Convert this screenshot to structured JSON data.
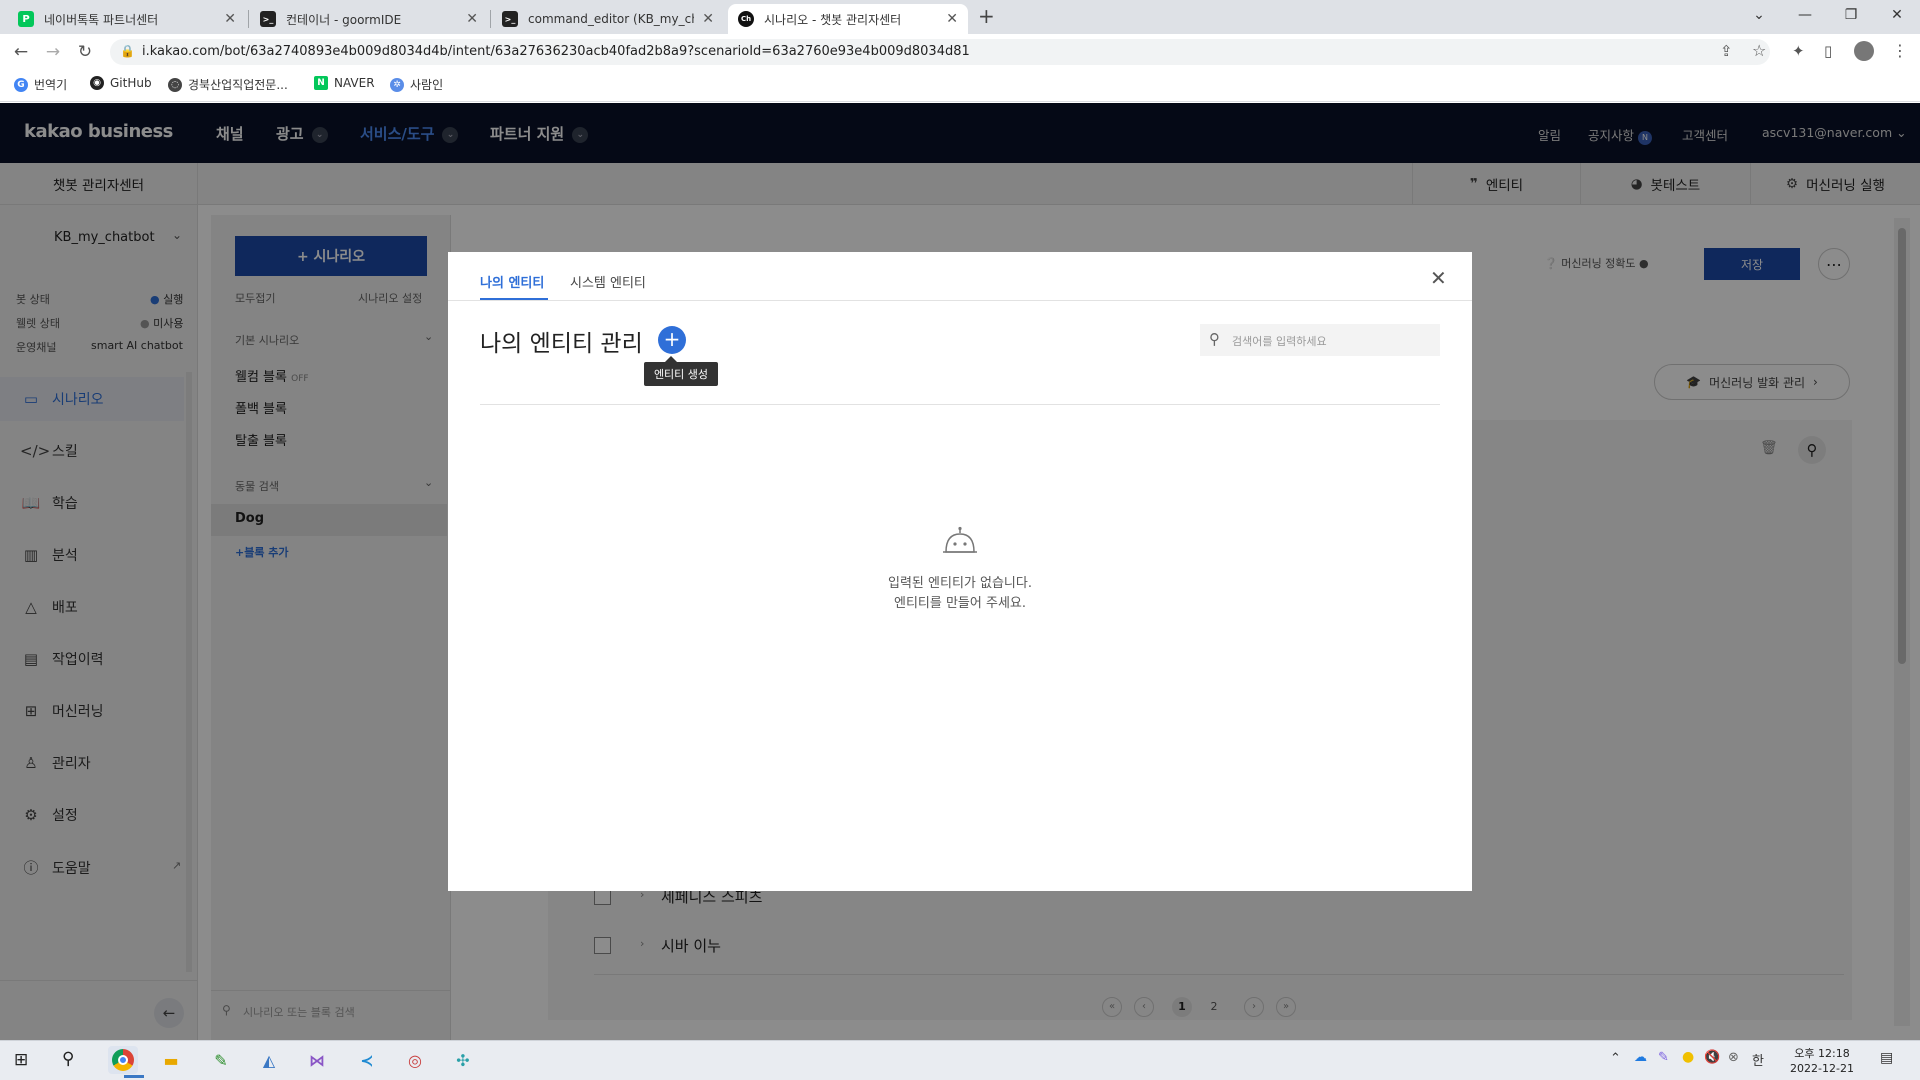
{
  "browser": {
    "tabs": [
      {
        "title": "네이버톡톡 파트너센터",
        "favicon": "P",
        "color": "#03c75a"
      },
      {
        "title": "컨테이너 - goormIDE",
        "favicon": ">_",
        "color": "#222"
      },
      {
        "title": "command_editor (KB_my_chatbo",
        "favicon": ">_",
        "color": "#222"
      },
      {
        "title": "시나리오 - 챗봇 관리자센터",
        "favicon": "Ch",
        "color": "#111"
      }
    ],
    "url": "i.kakao.com/bot/63a2740893e4b009d8034d4b/intent/63a27636230acb40fad2b8a9?scenarioId=63a2760e93e4b009d8034d81",
    "bookmarks": [
      "번역기",
      "GitHub",
      "경북산업직업전문...",
      "NAVER",
      "사람인"
    ]
  },
  "header": {
    "logo": "kakao business",
    "nav": [
      "채널",
      "광고",
      "서비스/도구",
      "파트너 지원"
    ],
    "right": [
      "알림",
      "공지사항",
      "고객센터",
      "ascv131@naver.com"
    ],
    "notice_badge": "N"
  },
  "subheader": {
    "title": "챗봇 관리자센터",
    "tools": [
      "엔티티",
      "봇테스트",
      "머신러닝 실행"
    ]
  },
  "left_sidebar": {
    "bot_name": "KB_my_chatbot",
    "status_rows": [
      {
        "label": "봇 상태",
        "value": "실행"
      },
      {
        "label": "웰렛 상태",
        "value": "미사용"
      },
      {
        "label": "운영채널",
        "value": "smart AI chatbot"
      }
    ],
    "menu": [
      "시나리오",
      "스킬",
      "학습",
      "분석",
      "배포",
      "작업이력",
      "머신러닝",
      "관리자",
      "설정",
      "도움말"
    ]
  },
  "scenario_panel": {
    "add_button": "+ 시나리오",
    "collapse_all": "모두접기",
    "scenario_settings": "시나리오 설정",
    "group_basic": "기본 시나리오",
    "blocks_basic": [
      "웰컴 블록",
      "폴백 블록",
      "탈출 블록"
    ],
    "welcome_off": "OFF",
    "group_search": "동물 검색",
    "blocks_search": [
      "Dog"
    ],
    "add_block": "+블록 추가",
    "search_placeholder": "시나리오 또는 블록 검색"
  },
  "main": {
    "ml_accuracy": "머신러닝 정확도",
    "save": "저장",
    "ml_manage": "머신러닝 발화 관리",
    "rows": [
      "세페니스 스피츠",
      "시바 이누"
    ],
    "pages": [
      "1",
      "2"
    ]
  },
  "modal": {
    "tabs": [
      "나의 엔티티",
      "시스템 엔티티"
    ],
    "title": "나의 엔티티 관리",
    "tooltip": "엔티티 생성",
    "search_placeholder": "검색어를 입력하세요",
    "empty_line1": "입력된 엔티티가 없습니다.",
    "empty_line2": "엔티티를 만들어 주세요."
  },
  "taskbar": {
    "time": "오후 12:18",
    "date": "2022-12-21",
    "ime": "한"
  },
  "colors": {
    "accent": "#2f6fd8",
    "header_bg": "#0a1128",
    "primary_btn": "#1d4aa8"
  }
}
